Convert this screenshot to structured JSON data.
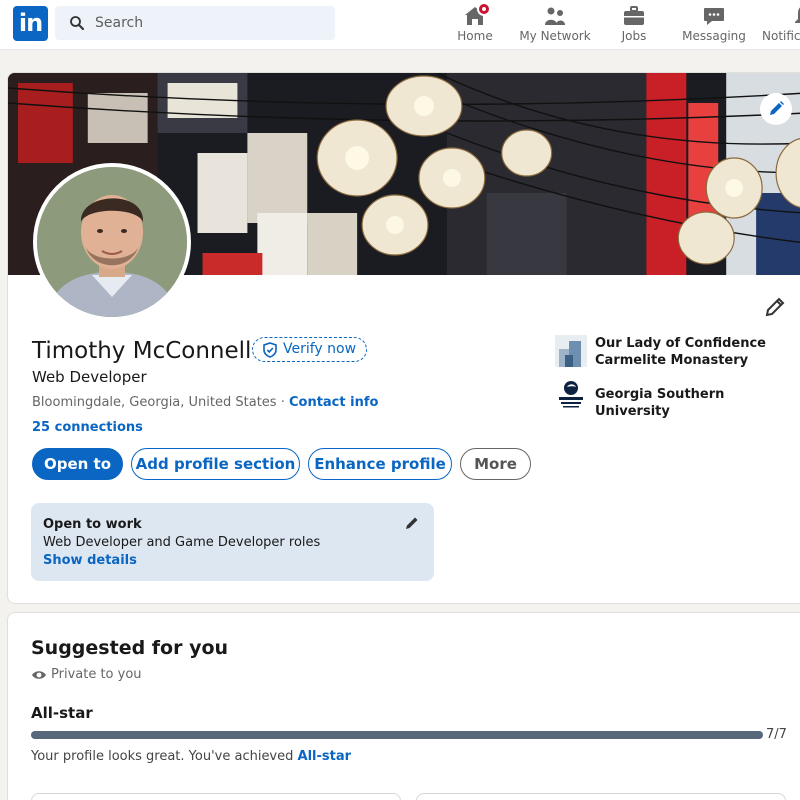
{
  "nav": {
    "search_placeholder": "Search",
    "items": [
      {
        "label": "Home",
        "icon": "home-icon"
      },
      {
        "label": "My Network",
        "icon": "people-icon"
      },
      {
        "label": "Jobs",
        "icon": "briefcase-icon"
      },
      {
        "label": "Messaging",
        "icon": "chat-icon"
      },
      {
        "label": "Notifica",
        "icon": "bell-icon"
      }
    ]
  },
  "profile": {
    "name": "Timothy McConnell",
    "verify_label": "Verify now",
    "headline": "Web Developer",
    "location": "Bloomingdale, Georgia, United States",
    "location_separator": " · ",
    "contact_label": "Contact info",
    "connections": "25 connections",
    "buttons": {
      "open_to": "Open to",
      "add_section": "Add profile section",
      "enhance": "Enhance profile",
      "more": "More"
    },
    "organizations": [
      {
        "name": "Our Lady of Confidence Carmelite Monastery"
      },
      {
        "name": "Georgia Southern University"
      }
    ],
    "open_to_work": {
      "title": "Open to work",
      "roles": "Web Developer and Game Developer roles",
      "link": "Show details"
    }
  },
  "suggested": {
    "title": "Suggested for you",
    "privacy": "Private to you",
    "level": "All-star",
    "progress_fraction": 1.0,
    "progress_count": "7/7",
    "message_prefix": "Your profile looks great. You've achieved ",
    "message_link": "All-star"
  },
  "colors": {
    "brand": "#0a66c2",
    "notification": "#cb112d",
    "open_to_work_bg": "#dde7f1"
  }
}
